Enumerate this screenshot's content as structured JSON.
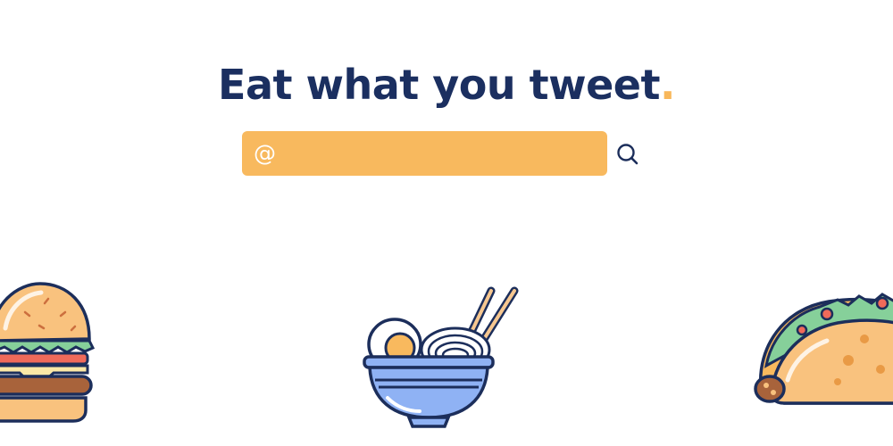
{
  "header": {
    "title": "Eat what you tweet",
    "title_period": "."
  },
  "search": {
    "prefix": "@",
    "value": "",
    "placeholder": "",
    "icon": "search-icon"
  },
  "illustrations": [
    {
      "name": "burger-icon"
    },
    {
      "name": "ramen-bowl-icon"
    },
    {
      "name": "taco-icon"
    }
  ],
  "colors": {
    "title": "#1b2f60",
    "accent": "#f8b75a",
    "search_field": "#f8b95e",
    "outline": "#1c2e5b",
    "bowl": "#8fb2f4"
  }
}
